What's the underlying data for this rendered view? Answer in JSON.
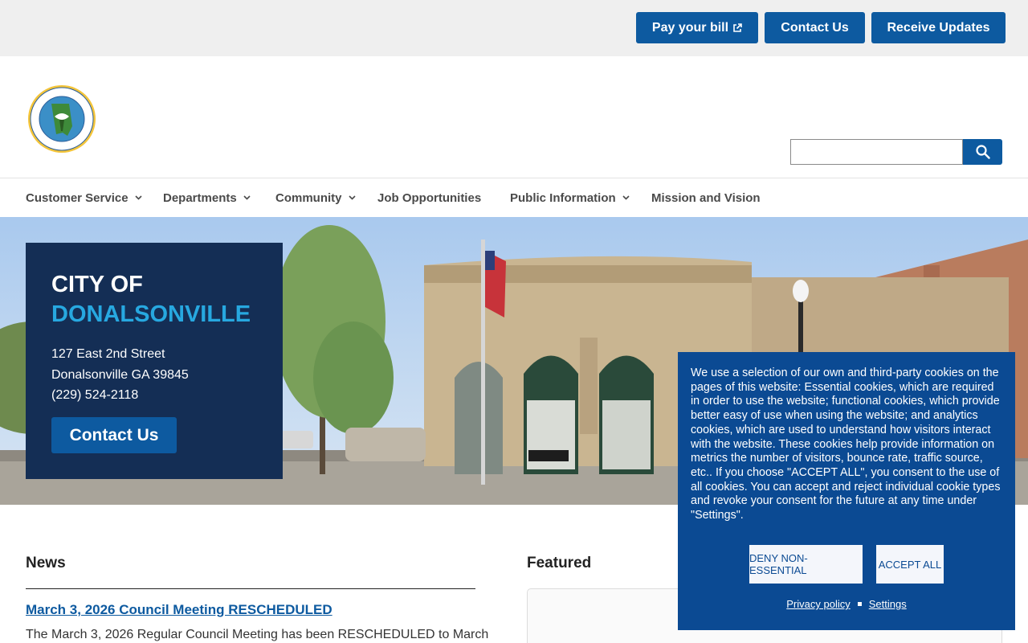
{
  "utility": {
    "pay_bill": "Pay your bill",
    "contact": "Contact Us",
    "updates": "Receive Updates"
  },
  "header": {
    "seal_alt": "City of Donalsonville Georgia seal",
    "search": {
      "value": "",
      "placeholder": ""
    }
  },
  "nav": {
    "items": [
      {
        "label": "Customer Service",
        "dropdown": true
      },
      {
        "label": "Departments",
        "dropdown": true
      },
      {
        "label": "Community",
        "dropdown": true
      },
      {
        "label": "Job Opportunities",
        "dropdown": false
      },
      {
        "label": "Public Information",
        "dropdown": true
      },
      {
        "label": "Mission and Vision",
        "dropdown": false
      }
    ]
  },
  "hero": {
    "city_line1": "CITY OF",
    "city_line2": "DONALSONVILLE",
    "address1": "127 East 2nd Street",
    "address2": "Donalsonville GA 39845",
    "phone": "(229) 524-2118",
    "contact_button": "Contact Us"
  },
  "news": {
    "heading": "News",
    "items": [
      {
        "title": "March 3, 2026 Council Meeting RESCHEDULED",
        "excerpt": "The March 3, 2026 Regular Council Meeting has been RESCHEDULED to March"
      }
    ]
  },
  "featured": {
    "heading": "Featured"
  },
  "cookie": {
    "text": "We use a selection of our own and third-party cookies on the pages of this website: Essential cookies, which are required in order to use the website; functional cookies, which provide better easy of use when using the website; and analytics cookies, which are used to understand how visitors interact with the website. These cookies help provide information on metrics the number of visitors, bounce rate, traffic source, etc.. If you choose \"ACCEPT ALL\", you consent to the use of all cookies. You can accept and reject individual cookie types and revoke your consent for the future at any time under \"Settings\".",
    "deny": "DENY NON-ESSENTIAL",
    "accept": "ACCEPT ALL",
    "privacy": "Privacy policy",
    "settings": "Settings"
  },
  "colors": {
    "primary_blue": "#0d5aa0",
    "card_navy": "#142e55",
    "accent_cyan": "#27a8e0",
    "cookie_blue": "#0b4a93"
  },
  "icons": [
    "external-link-icon",
    "search-icon",
    "chevron-down-icon",
    "city-seal"
  ]
}
